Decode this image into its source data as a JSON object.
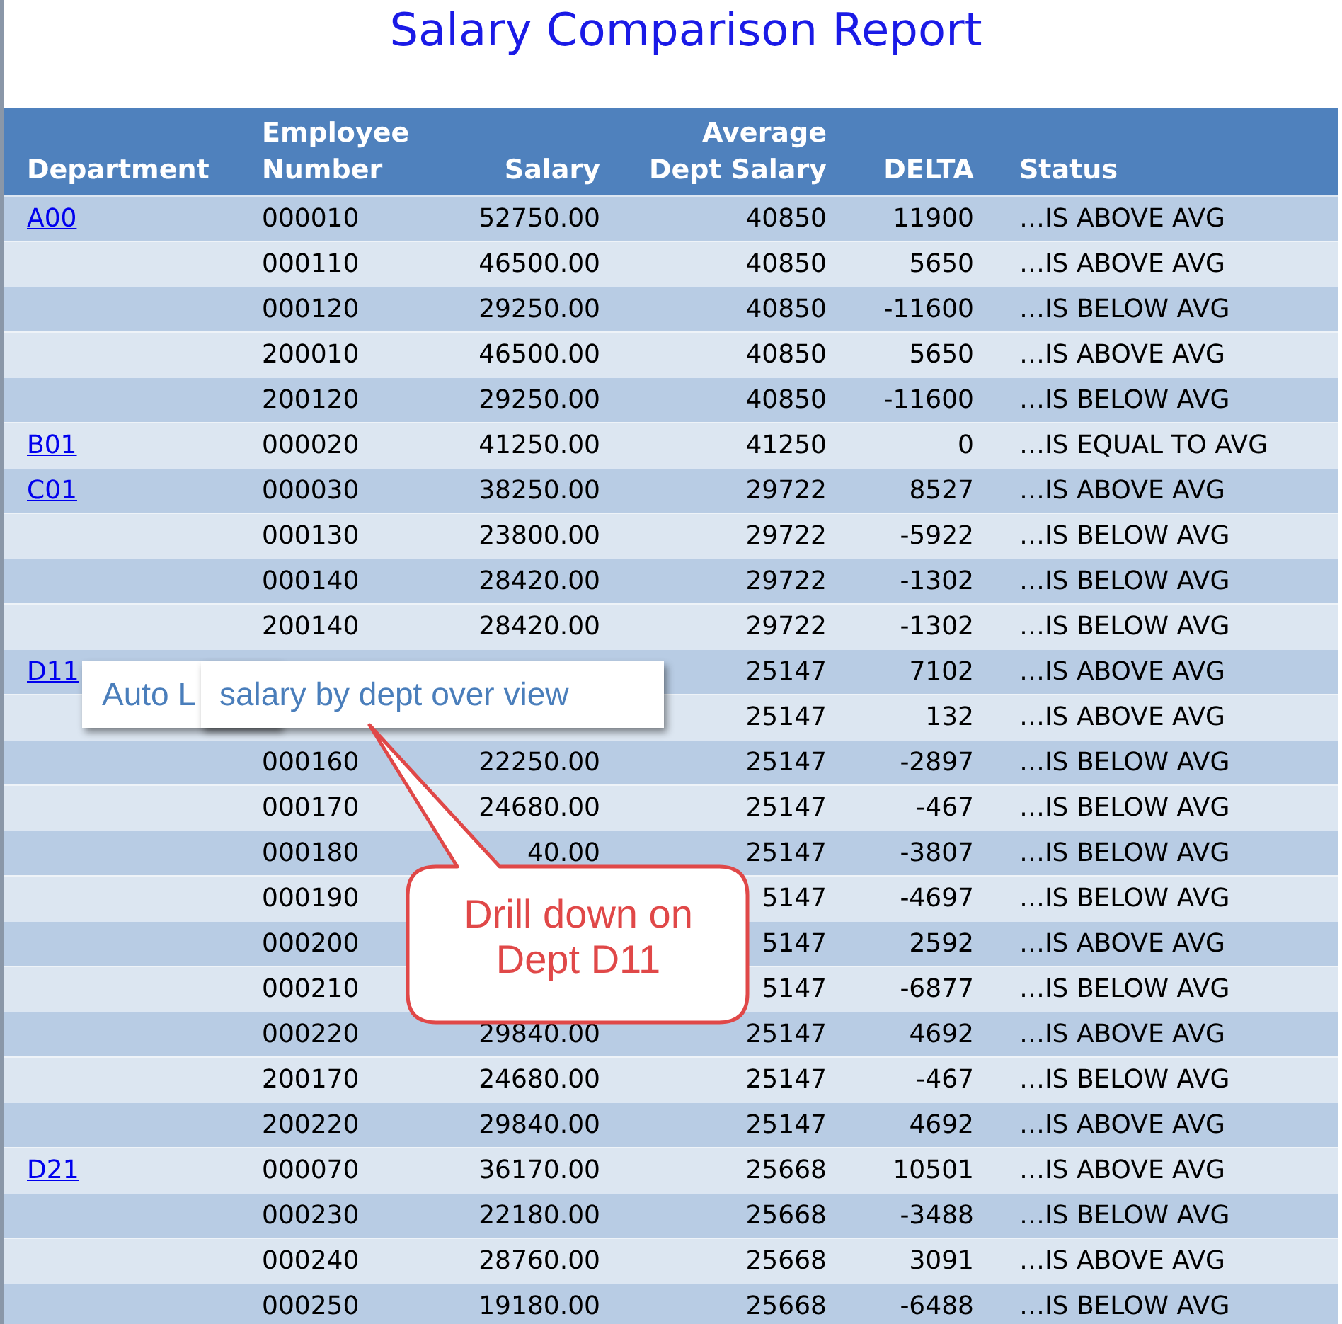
{
  "title": "Salary Comparison Report",
  "columns": [
    "Department",
    "Employee Number",
    "Salary",
    "Average Dept Salary",
    "DELTA",
    "Status"
  ],
  "rows": [
    {
      "department": "A00",
      "employee": "000010",
      "salary": "52750.00",
      "avg": "40850",
      "delta": "11900",
      "status": "…IS ABOVE AVG"
    },
    {
      "employee": "000110",
      "salary": "46500.00",
      "avg": "40850",
      "delta": "5650",
      "status": "…IS ABOVE AVG"
    },
    {
      "employee": "000120",
      "salary": "29250.00",
      "avg": "40850",
      "delta": "-11600",
      "status": "…IS BELOW AVG"
    },
    {
      "employee": "200010",
      "salary": "46500.00",
      "avg": "40850",
      "delta": "5650",
      "status": "…IS ABOVE AVG"
    },
    {
      "employee": "200120",
      "salary": "29250.00",
      "avg": "40850",
      "delta": "-11600",
      "status": "…IS BELOW AVG"
    },
    {
      "department": "B01",
      "employee": "000020",
      "salary": "41250.00",
      "avg": "41250",
      "delta": "0",
      "status": "…IS EQUAL TO AVG"
    },
    {
      "department": "C01",
      "employee": "000030",
      "salary": "38250.00",
      "avg": "29722",
      "delta": "8527",
      "status": "…IS ABOVE AVG"
    },
    {
      "employee": "000130",
      "salary": "23800.00",
      "avg": "29722",
      "delta": "-5922",
      "status": "…IS BELOW AVG"
    },
    {
      "employee": "000140",
      "salary": "28420.00",
      "avg": "29722",
      "delta": "-1302",
      "status": "…IS BELOW AVG"
    },
    {
      "employee": "200140",
      "salary": "28420.00",
      "avg": "29722",
      "delta": "-1302",
      "status": "…IS BELOW AVG"
    },
    {
      "department": "D11",
      "avg": "25147",
      "delta": "7102",
      "status": "…IS ABOVE AVG"
    },
    {
      "avg": "25147",
      "delta": "132",
      "status": "…IS ABOVE AVG"
    },
    {
      "employee": "000160",
      "salary": "22250.00",
      "avg": "25147",
      "delta": "-2897",
      "status": "…IS BELOW AVG"
    },
    {
      "employee": "000170",
      "salary": "24680.00",
      "avg": "25147",
      "delta": "-467",
      "status": "…IS BELOW AVG"
    },
    {
      "employee": "000180",
      "salary": "40.00",
      "avg": "25147",
      "delta": "-3807",
      "status": "…IS BELOW AVG"
    },
    {
      "employee": "000190",
      "avg": "5147",
      "delta": "-4697",
      "status": "…IS BELOW AVG"
    },
    {
      "employee": "000200",
      "avg": "5147",
      "delta": "2592",
      "status": "…IS ABOVE AVG"
    },
    {
      "employee": "000210",
      "avg": "5147",
      "delta": "-6877",
      "status": "…IS BELOW AVG"
    },
    {
      "employee": "000220",
      "salary": "29840.00",
      "avg": "25147",
      "delta": "4692",
      "status": "…IS ABOVE AVG"
    },
    {
      "employee": "200170",
      "salary": "24680.00",
      "avg": "25147",
      "delta": "-467",
      "status": "…IS BELOW AVG"
    },
    {
      "employee": "200220",
      "salary": "29840.00",
      "avg": "25147",
      "delta": "4692",
      "status": "…IS ABOVE AVG"
    },
    {
      "department": "D21",
      "employee": "000070",
      "salary": "36170.00",
      "avg": "25668",
      "delta": "10501",
      "status": "…IS ABOVE AVG"
    },
    {
      "employee": "000230",
      "salary": "22180.00",
      "avg": "25668",
      "delta": "-3488",
      "status": "…IS BELOW AVG"
    },
    {
      "employee": "000240",
      "salary": "28760.00",
      "avg": "25668",
      "delta": "3091",
      "status": "…IS ABOVE AVG"
    },
    {
      "employee": "000250",
      "salary": "19180.00",
      "avg": "25668",
      "delta": "-6488",
      "status": "…IS BELOW AVG"
    }
  ],
  "tooltips": [
    "Auto L",
    "salary by dept over view"
  ],
  "callout": "Drill down on Dept D11"
}
